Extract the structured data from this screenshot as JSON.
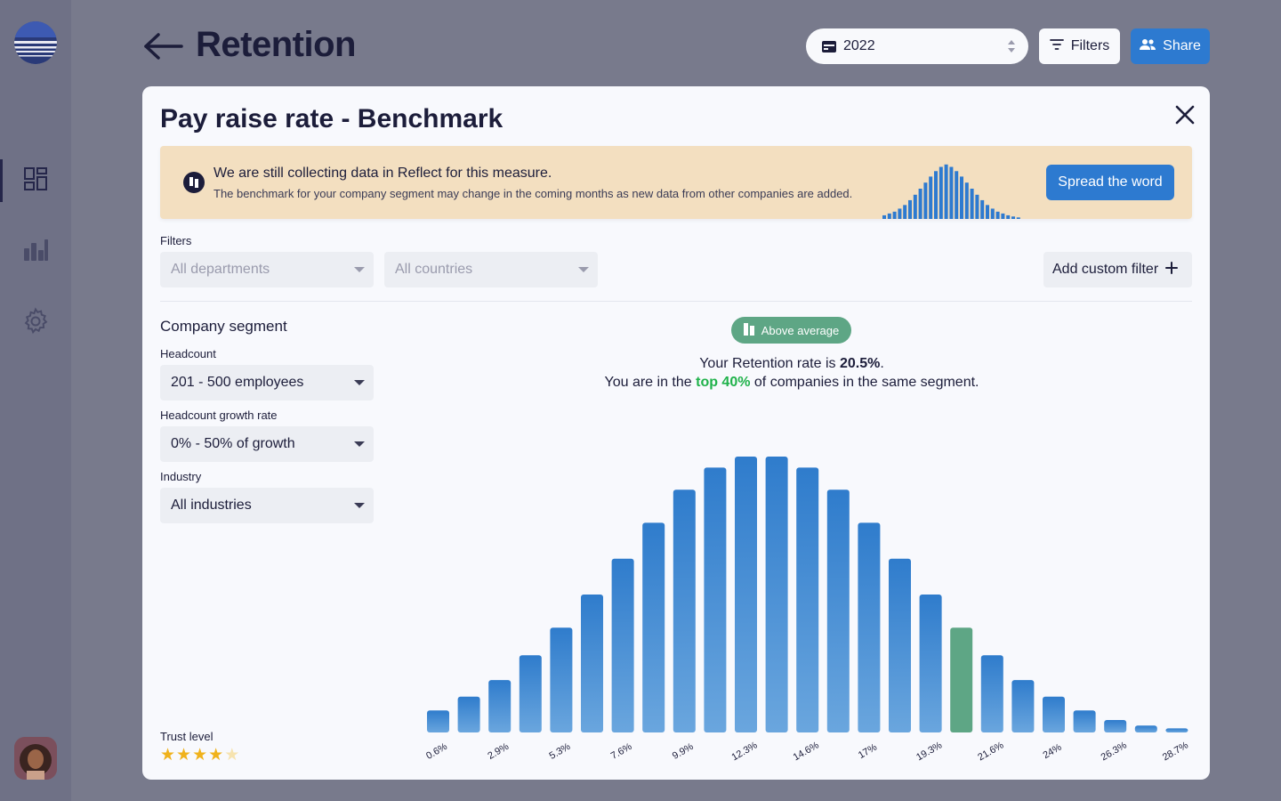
{
  "header": {
    "title": "Retention",
    "year": "2022",
    "filters_label": "Filters",
    "share_label": "Share"
  },
  "sidebar": {
    "items": [
      {
        "name": "dashboard-icon",
        "active": true
      },
      {
        "name": "bar-chart-icon",
        "active": false
      },
      {
        "name": "gear-icon",
        "active": false
      }
    ]
  },
  "modal": {
    "title": "Pay raise rate - Benchmark",
    "banner": {
      "title": "We are still collecting data in Reflect for this measure.",
      "subtitle": "The benchmark for your company segment may change in the coming months as new data from other companies are added.",
      "button": "Spread the word"
    },
    "filters": {
      "label": "Filters",
      "departments": "All departments",
      "countries": "All countries",
      "add_custom": "Add custom filter"
    },
    "segment": {
      "title": "Company segment",
      "headcount_label": "Headcount",
      "headcount_value": "201 - 500 employees",
      "growth_label": "Headcount growth rate",
      "growth_value": "0% - 50% of growth",
      "industry_label": "Industry",
      "industry_value": "All industries"
    },
    "trust": {
      "label": "Trust level",
      "rating": 4,
      "max": 5
    },
    "result": {
      "badge": "Above average",
      "line1_prefix": "Your Retention rate is ",
      "line1_value": "20.5%",
      "line1_suffix": ".",
      "line2_prefix": "You are in the ",
      "line2_highlight": "top 40%",
      "line2_suffix": " of companies in the same segment."
    }
  },
  "colors": {
    "bar_top": "#2f7ccc",
    "bar_bottom": "#6aa6de",
    "highlight": "#5ea685",
    "accent": "#2d7ad0"
  },
  "chart_data": {
    "type": "bar",
    "tick_labels": [
      "0.6%",
      "2.9%",
      "5.3%",
      "7.6%",
      "9.9%",
      "12.3%",
      "14.6%",
      "17%",
      "19.3%",
      "21.6%",
      "24%",
      "26.3%",
      "28.7%"
    ],
    "values": [
      8,
      13,
      19,
      28,
      38,
      50,
      63,
      76,
      88,
      96,
      100,
      100,
      96,
      88,
      76,
      63,
      50,
      38,
      28,
      19,
      13,
      8,
      4.5,
      2.5,
      1.5
    ],
    "highlight_index": 17,
    "ylim": [
      0,
      100
    ]
  },
  "banner_mini_chart": {
    "values": [
      6,
      9,
      12,
      17,
      23,
      31,
      40,
      50,
      60,
      70,
      79,
      86,
      90,
      86,
      79,
      70,
      60,
      50,
      40,
      31,
      23,
      17,
      12,
      9,
      6,
      4,
      2.5
    ]
  }
}
